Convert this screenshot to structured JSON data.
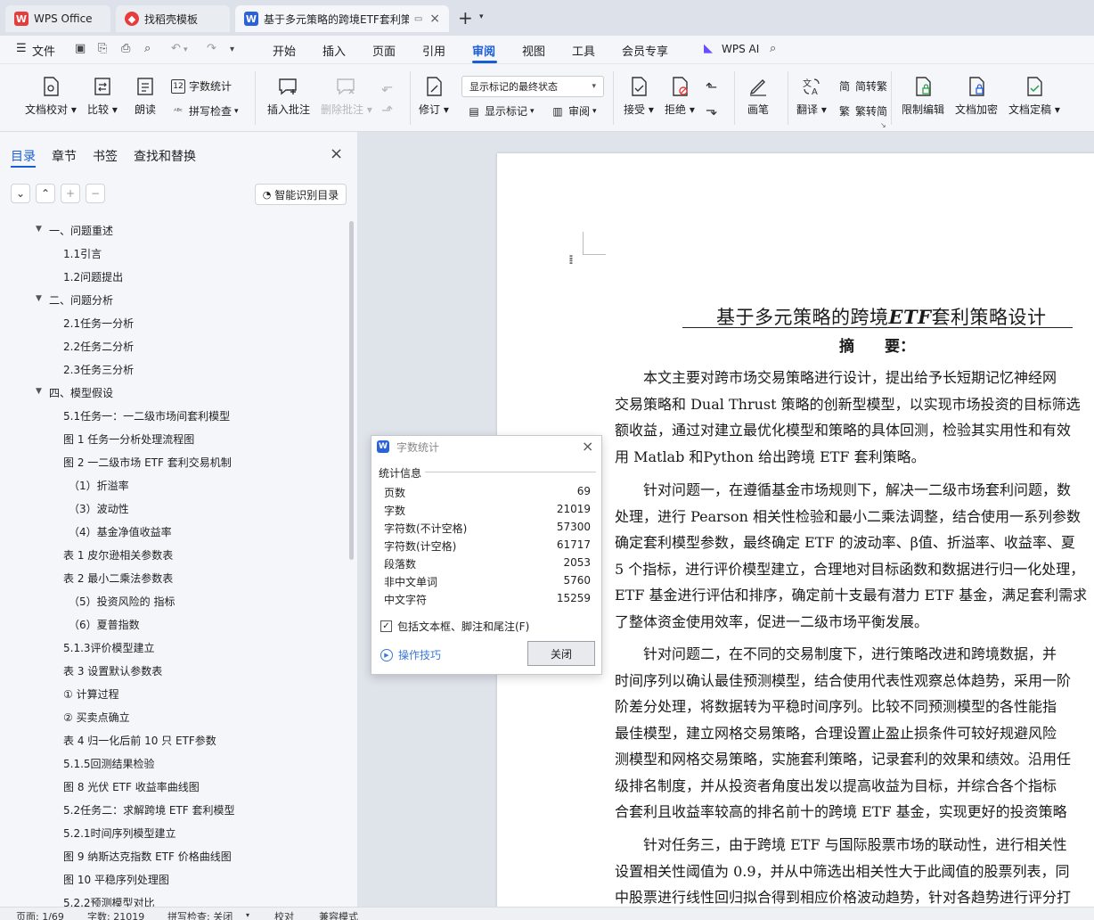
{
  "tabs": [
    {
      "label": "WPS Office"
    },
    {
      "label": "找稻壳模板"
    },
    {
      "label": "基于多元策略的跨境ETF套利策"
    }
  ],
  "menu": {
    "file": "文件",
    "items": [
      "开始",
      "插入",
      "页面",
      "引用",
      "审阅",
      "视图",
      "工具",
      "会员专享"
    ],
    "active": "审阅",
    "ai": "WPS AI"
  },
  "ribbon": {
    "doc_check": "文档校对",
    "compare": "比较",
    "read": "朗读",
    "word_count": "字数统计",
    "spell_check": "拼写检查",
    "insert_comment": "插入批注",
    "delete_comment": "删除批注",
    "revise": "修订",
    "markup_state": "显示标记的最终状态",
    "show_markup": "显示标记",
    "review": "审阅",
    "accept": "接受",
    "reject": "拒绝",
    "pen": "画笔",
    "translate": "翻译",
    "to_trad": "简转繁",
    "to_simp": "繁转简",
    "restrict_edit": "限制编辑",
    "encrypt": "文档加密",
    "finalize": "文档定稿"
  },
  "sidebar": {
    "tabs": [
      "目录",
      "章节",
      "书签",
      "查找和替换"
    ],
    "active_tab": "目录",
    "smart_toc": "智能识别目录",
    "toc": [
      {
        "label": "一、问题重述",
        "level": 1
      },
      {
        "label": "1.1引言",
        "level": 2
      },
      {
        "label": "1.2问题提出",
        "level": 2
      },
      {
        "label": "二、问题分析",
        "level": 1
      },
      {
        "label": "2.1任务一分析",
        "level": 2
      },
      {
        "label": "2.2任务二分析",
        "level": 2
      },
      {
        "label": "2.3任务三分析",
        "level": 2
      },
      {
        "label": "四、模型假设",
        "level": 1
      },
      {
        "label": "5.1任务一：一二级市场间套利模型",
        "level": 2
      },
      {
        "label": "图 1 任务一分析处理流程图",
        "level": 2
      },
      {
        "label": "图 2 一二级市场 ETF 套利交易机制",
        "level": 2
      },
      {
        "label": "（1）折溢率",
        "level": 3
      },
      {
        "label": "（3）波动性",
        "level": 3
      },
      {
        "label": "（4）基金净值收益率",
        "level": 3
      },
      {
        "label": "表 1 皮尔逊相关参数表",
        "level": 2
      },
      {
        "label": "表 2 最小二乘法参数表",
        "level": 2
      },
      {
        "label": "（5）投资风险的    指标",
        "level": 3
      },
      {
        "label": "（6）夏普指数",
        "level": 3
      },
      {
        "label": "5.1.3评价模型建立",
        "level": 2
      },
      {
        "label": "表 3 设置默认参数表",
        "level": 2
      },
      {
        "label": "① 计算过程",
        "level": 2
      },
      {
        "label": "② 买卖点确立",
        "level": 2
      },
      {
        "label": "表 4 归一化后前 10 只 ETF参数",
        "level": 2
      },
      {
        "label": "5.1.5回测结果检验",
        "level": 2
      },
      {
        "label": "图 8 光伏 ETF 收益率曲线图",
        "level": 2
      },
      {
        "label": "5.2任务二：求解跨境 ETF 套利模型",
        "level": 2
      },
      {
        "label": "5.2.1时间序列模型建立",
        "level": 2
      },
      {
        "label": "图 9 纳斯达克指数 ETF 价格曲线图",
        "level": 2
      },
      {
        "label": "图 10 平稳序列处理图",
        "level": 2
      },
      {
        "label": "5.2.2预测模型对比",
        "level": 2
      }
    ]
  },
  "document": {
    "title_prefix": "基于多元策略的跨境",
    "title_etf": "ETF",
    "title_suffix": "套利策略设计",
    "abstract": "摘　　要：",
    "p1": [
      "　　本文主要对跨市场交易策略进行设计，提出给予长短期记忆神经网",
      "交易策略和 Dual Thrust 策略的创新型模型，以实现市场投资的目标筛选",
      "额收益，通过对建立最优化模型和策略的具体回测，检验其实用性和有效",
      "用 Matlab 和Python 给出跨境 ETF 套利策略。"
    ],
    "p2": [
      "　　针对问题一，在遵循基金市场规则下，解决一二级市场套利问题，数",
      "处理，进行 Pearson 相关性检验和最小二乘法调整，结合使用一系列参数",
      "确定套利模型参数，最终确定 ETF 的波动率、β值、折溢率、收益率、夏",
      "5 个指标，进行评价模型建立，合理地对目标函数和数据进行归一化处理，",
      "ETF 基金进行评估和排序，确定前十支最有潜力 ETF 基金，满足套利需求",
      "了整体资金使用效率，促进一二级市场平衡发展。"
    ],
    "p3": [
      "　　针对问题二，在不同的交易制度下，进行策略改进和跨境数据，并",
      "时间序列以确认最佳预测模型，结合使用代表性观察总体趋势，采用一阶",
      "阶差分处理，将数据转为平稳时间序列。比较不同预测模型的各性能指",
      "最佳模型，建立网格交易策略，合理设置止盈止损条件可较好规避风险",
      "测模型和网格交易策略，实施套利策略，记录套利的效果和绩效。沿用任",
      "级排名制度，并从投资者角度出发以提高收益为目标，并综合各个指标",
      "合套利且收益率较高的排名前十的跨境 ETF 基金，实现更好的投资策略"
    ],
    "p4": [
      "　　针对任务三，由于跨境 ETF 与国际股票市场的联动性，进行相关性",
      "设置相关性阈值为 0.9，并从中筛选出相关性大于此阈值的股票列表，同",
      "中股票进行线性回归拟合得到相应价格波动趋势，针对各趋势进行评分打"
    ]
  },
  "dialog": {
    "title": "字数统计",
    "section": "统计信息",
    "rows": [
      {
        "label": "页数",
        "value": "69"
      },
      {
        "label": "字数",
        "value": "21019"
      },
      {
        "label": "字符数(不计空格)",
        "value": "57300"
      },
      {
        "label": "字符数(计空格)",
        "value": "61717"
      },
      {
        "label": "段落数",
        "value": "2053"
      },
      {
        "label": "非中文单词",
        "value": "5760"
      },
      {
        "label": "中文字符",
        "value": "15259"
      }
    ],
    "checkbox": "包括文本框、脚注和尾注(F)",
    "tips": "操作技巧",
    "close": "关闭"
  },
  "status": {
    "page": "页面: 1/69",
    "words": "字数: 21019",
    "spell": "拼写检查: 关闭",
    "proof": "校对",
    "compat": "兼容模式"
  },
  "colors": {
    "accent": "#1a5dd6",
    "wps_red": "#e63c3c",
    "brand_blue": "#2b62d9"
  }
}
